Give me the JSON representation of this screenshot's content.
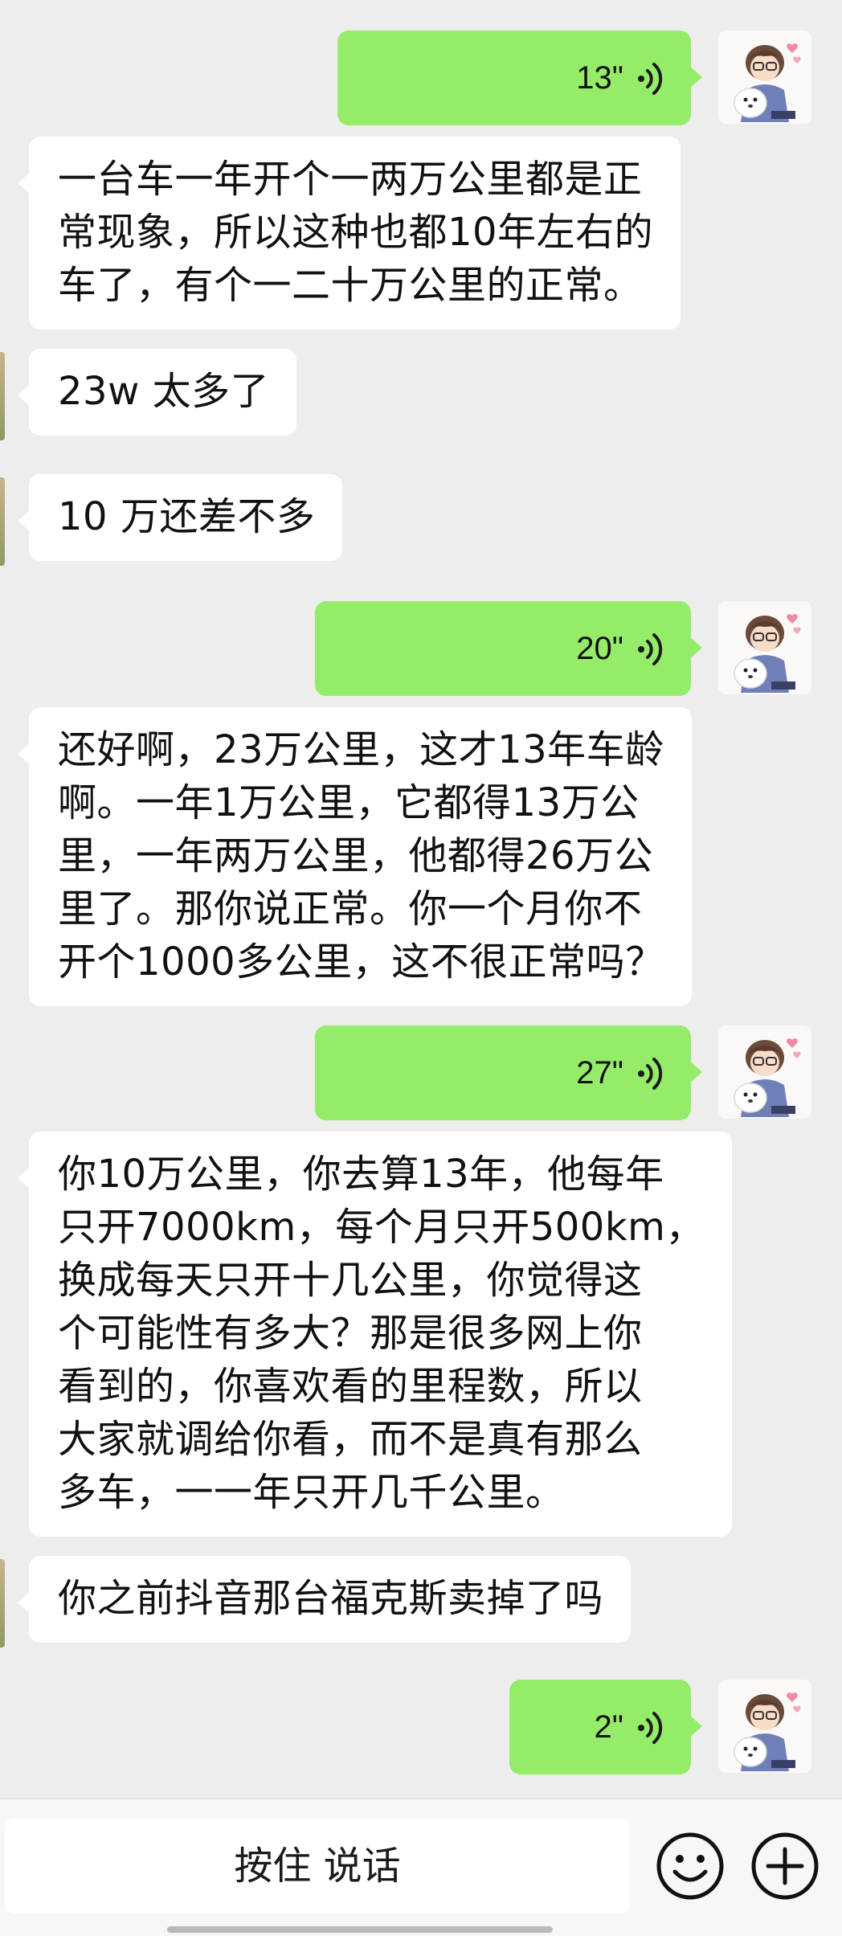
{
  "messages": [
    {
      "type": "voice",
      "duration": "13\""
    },
    {
      "type": "text",
      "lines": [
        "一台车一年开个一两万公里都是正",
        "常现象，所以这种也都10年左右的",
        "车了，有个一二十万公里的正常。"
      ]
    },
    {
      "type": "text",
      "lines": [
        "23w 太多了"
      ]
    },
    {
      "type": "text",
      "lines": [
        "10 万还差不多"
      ]
    },
    {
      "type": "voice",
      "duration": "20\""
    },
    {
      "type": "text",
      "lines": [
        "还好啊，23万公里，这才13年车龄",
        "啊。一年1万公里，它都得13万公",
        "里，一年两万公里，他都得26万公",
        "里了。那你说正常。你一个月你不",
        "开个1000多公里，这不很正常吗？"
      ]
    },
    {
      "type": "voice",
      "duration": "27\""
    },
    {
      "type": "text",
      "lines": [
        "你10万公里，你去算13年，他每年",
        "只开7000km，每个月只开500km，",
        "换成每天只开十几公里，你觉得这",
        "个可能性有多大？那是很多网上你",
        "看到的，你喜欢看的里程数，所以",
        "大家就调给你看，而不是真有那么",
        "多车，一一年只开几千公里。"
      ]
    },
    {
      "type": "text",
      "lines": [
        "你之前抖音那台福克斯卖掉了吗"
      ]
    },
    {
      "type": "voice",
      "duration": "2\""
    }
  ],
  "input_bar": {
    "hold_to_talk": "按住 说话",
    "emoji_icon": "smiley-face-icon",
    "plus_icon": "plus-circle-icon"
  },
  "colors": {
    "sent_bubble": "#95ec69",
    "received_bubble": "#ffffff",
    "background": "#ededed"
  },
  "icons": {
    "voice": "voice-wave-icon",
    "self_avatar": "anime-boy-with-white-dog-avatar"
  }
}
